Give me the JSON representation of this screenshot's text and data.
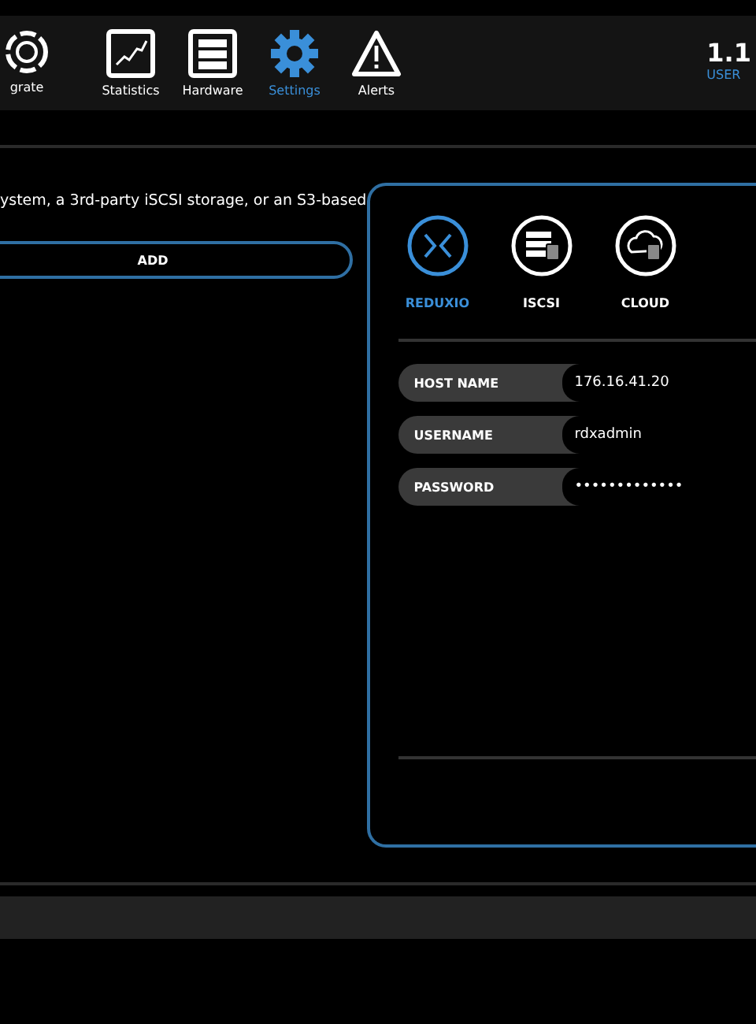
{
  "nav": [
    {
      "label": "grate",
      "kind": "migrate",
      "selected": false
    },
    {
      "label": "Statistics",
      "kind": "statistics",
      "selected": false
    },
    {
      "label": "Hardware",
      "kind": "hardware",
      "selected": false
    },
    {
      "label": "Settings",
      "kind": "settings",
      "selected": true
    },
    {
      "label": "Alerts",
      "kind": "alerts",
      "selected": false
    }
  ],
  "header_right": {
    "version": "1.1",
    "user": "USER"
  },
  "description": "ystem, a 3rd-party iSCSI storage, or an S3-based",
  "add_button": "ADD",
  "storage_types": [
    {
      "label": "REDUXIO",
      "kind": "reduxio",
      "selected": true
    },
    {
      "label": "ISCSI",
      "kind": "iscsi",
      "selected": false
    },
    {
      "label": "CLOUD",
      "kind": "cloud",
      "selected": false
    }
  ],
  "fields": [
    {
      "label": "HOST NAME",
      "value": "176.16.41.20"
    },
    {
      "label": "USERNAME",
      "value": "rdxadmin"
    },
    {
      "label": "PASSWORD",
      "value": "•••••••••••••"
    }
  ]
}
